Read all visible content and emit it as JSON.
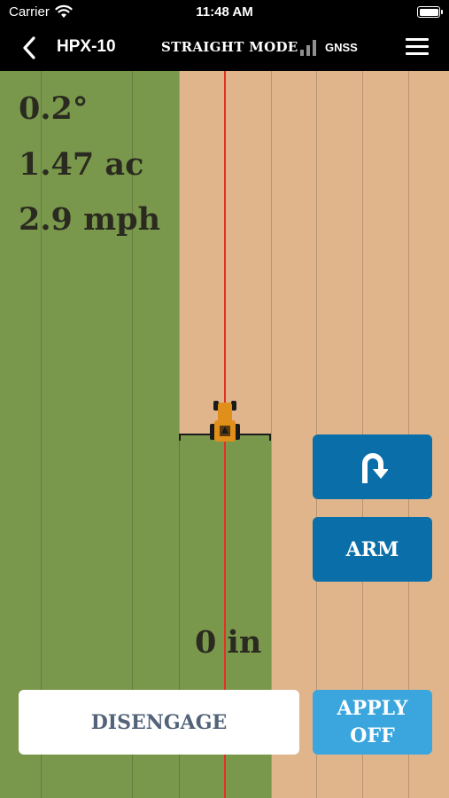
{
  "status_bar": {
    "carrier": "Carrier",
    "time": "11:48 AM",
    "wifi_icon": "wifi-icon",
    "battery_icon": "battery-icon"
  },
  "nav_bar": {
    "title": "HPX-10",
    "mode": "STRAIGHT MODE",
    "signal_label": "GNSS",
    "back_icon": "chevron-left-icon",
    "signal_icon": "signal-bars-icon",
    "menu_icon": "hamburger-menu-icon"
  },
  "readouts": {
    "heading": "0.2°",
    "area": "1.47 ac",
    "speed": "2.9 mph",
    "cross_track_error": "0 in"
  },
  "buttons": {
    "uturn_icon": "u-turn-arrow-icon",
    "arm": "ARM",
    "disengage": "DISENGAGE",
    "apply_line1": "APPLY",
    "apply_line2": "OFF"
  },
  "colors": {
    "covered_area": "#79984c",
    "uncovered_field": "#e0b58c",
    "guidance_line": "#e03222",
    "button_primary": "#0a6ea8",
    "button_apply": "#3aa6dd",
    "tractor": "#e0901a"
  }
}
